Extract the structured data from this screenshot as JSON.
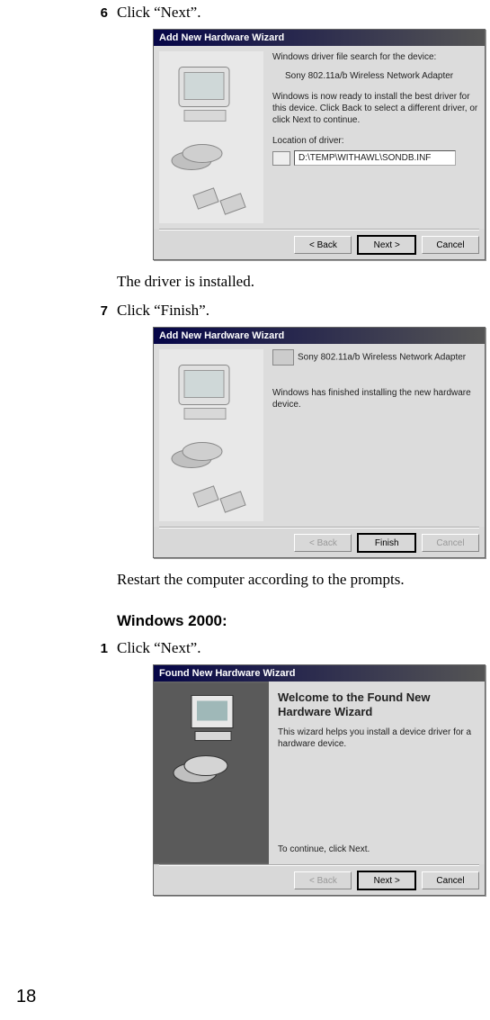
{
  "pageNumber": "18",
  "step6": {
    "num": "6",
    "text": "Click “Next”."
  },
  "dialog1": {
    "title": "Add New Hardware Wizard",
    "line1": "Windows driver file search for the device:",
    "device": "Sony 802.11a/b Wireless Network Adapter",
    "line2": "Windows is now ready to install the best driver for this device. Click Back to select a different driver, or click Next to continue.",
    "locLabel": "Location of driver:",
    "locPath": "D:\\TEMP\\WITHAWL\\SONDB.INF",
    "btnBack": "< Back",
    "btnNext": "Next >",
    "btnCancel": "Cancel"
  },
  "afterStep6": "The driver is installed.",
  "step7": {
    "num": "7",
    "text": "Click “Finish”."
  },
  "dialog2": {
    "title": "Add New Hardware Wizard",
    "device": "Sony 802.11a/b Wireless Network Adapter",
    "line1": "Windows has finished installing the new hardware device.",
    "btnBack": "< Back",
    "btnFinish": "Finish",
    "btnCancel": "Cancel"
  },
  "afterStep7": "Restart the computer according to the prompts.",
  "sectionHead": "Windows 2000:",
  "step1": {
    "num": "1",
    "text": "Click “Next”."
  },
  "dialog3": {
    "title": "Found New Hardware Wizard",
    "welcome": "Welcome to the Found New Hardware Wizard",
    "desc": "This wizard helps you install a device driver for a hardware device.",
    "cont": "To continue, click Next.",
    "btnBack": "< Back",
    "btnNext": "Next >",
    "btnCancel": "Cancel"
  }
}
